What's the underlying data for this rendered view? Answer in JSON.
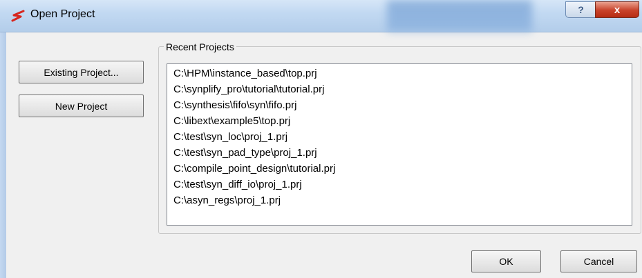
{
  "window": {
    "title": "Open Project",
    "help_label": "?",
    "close_label": "x"
  },
  "buttons": {
    "existing_project": "Existing Project...",
    "new_project": "New Project",
    "ok": "OK",
    "cancel": "Cancel"
  },
  "recent_projects": {
    "label": "Recent Projects",
    "items": [
      "C:\\HPM\\instance_based\\top.prj",
      "C:\\synplify_pro\\tutorial\\tutorial.prj",
      "C:\\synthesis\\fifo\\syn\\fifo.prj",
      "C:\\libext\\example5\\top.prj",
      "C:\\test\\syn_loc\\proj_1.prj",
      "C:\\test\\syn_pad_type\\proj_1.prj",
      "C:\\compile_point_design\\tutorial.prj",
      "C:\\test\\syn_diff_io\\proj_1.prj",
      "C:\\asyn_regs\\proj_1.prj"
    ]
  },
  "colors": {
    "titlebar": "#c2d9f2",
    "close_button": "#c8422a",
    "app_icon": "#d7261e"
  },
  "icons": {
    "app": "synplify-logo-icon"
  }
}
